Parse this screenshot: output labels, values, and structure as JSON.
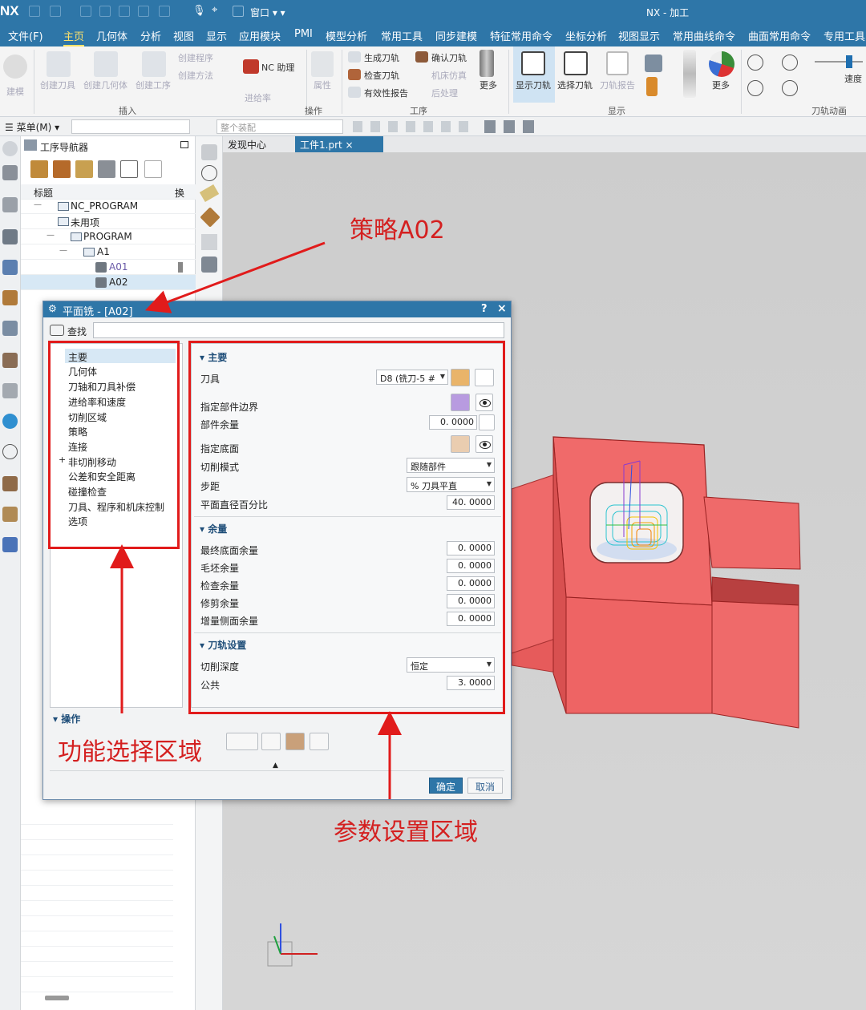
{
  "app": {
    "logo": "NX",
    "window_menu": "窗口",
    "window_title": "NX - 加工"
  },
  "menubar": [
    "文件(F)",
    "主页",
    "几何体",
    "分析",
    "视图",
    "显示",
    "应用模块",
    "PMI",
    "模型分析",
    "常用工具",
    "同步建模",
    "特征常用命令",
    "坐标分析",
    "视图显示",
    "常用曲线命令",
    "曲面常用命令",
    "专用工具"
  ],
  "menubar_active": "主页",
  "ribbon": {
    "b_build": "建模",
    "b_create_tool": "创建刀具",
    "b_create_geom": "创建几何体",
    "b_create_op": "创建工序",
    "b_create_prog": "创建程序",
    "b_create_method": "创建方法",
    "b_nc_assist": "NC 助理",
    "b_props": "属性",
    "b_feed": "进给率",
    "b_gen_path": "生成刀轨",
    "b_confirm_path": "确认刀轨",
    "b_check_path": "检查刀轨",
    "b_machine_sim": "机床仿真",
    "b_validity": "有效性报告",
    "b_postprocess": "后处理",
    "b_more1": "更多",
    "b_show_path": "显示刀轨",
    "b_select_path": "选择刀轨",
    "b_path_report": "刀轨报告",
    "b_more2": "更多",
    "b_speed": "速度",
    "g_insert": "插入",
    "g_operation": "操作",
    "g_workpiece": "工序",
    "g_display": "显示",
    "g_animation": "刀轨动画"
  },
  "toolbar2": {
    "menu_label": "菜单(M)",
    "assembly_combo": "整个装配"
  },
  "navigator": {
    "title": "工序导航器",
    "col_title": "标题",
    "col_change": "换",
    "tree": [
      "NC_PROGRAM",
      "未用项",
      "PROGRAM",
      "A1",
      "A01",
      "A02"
    ]
  },
  "tabs": {
    "discover": "发现中心",
    "part": "工件1.prt"
  },
  "dialog": {
    "title": "平面铣 - [A02]",
    "help": "?",
    "close": "×",
    "search_label": "查找",
    "func_items": [
      "主要",
      "几何体",
      "刀轴和刀具补偿",
      "进给率和速度",
      "切削区域",
      "策略",
      "连接",
      "非切削移动",
      "公差和安全距离",
      "碰撞检查",
      "刀具、程序和机床控制",
      "选项"
    ],
    "expand_item": "+",
    "sec_main": "主要",
    "lbl_tool": "刀具",
    "tool_value": "D8 (铣刀-5 #",
    "lbl_part_boundary": "指定部件边界",
    "lbl_part_stock": "部件余量",
    "part_stock": "0. 0000",
    "lbl_floor": "指定底面",
    "lbl_cut_pattern": "切削模式",
    "cut_pattern": "跟随部件",
    "lbl_stepover": "步距",
    "stepover": "% 刀具平直",
    "lbl_flat_pct": "平面直径百分比",
    "flat_pct": "40. 0000",
    "sec_stock": "余量",
    "lbl_final_floor": "最终底面余量",
    "final_floor": "0. 0000",
    "lbl_blank": "毛坯余量",
    "blank": "0. 0000",
    "lbl_check": "检查余量",
    "check": "0. 0000",
    "lbl_trim": "修剪余量",
    "trim": "0. 0000",
    "lbl_incr_side": "增量侧面余量",
    "incr_side": "0. 0000",
    "sec_path": "刀轨设置",
    "lbl_cut_depth": "切削深度",
    "cut_depth": "恒定",
    "lbl_common": "公共",
    "common": "3. 0000",
    "sec_ops": "操作",
    "ok": "确定",
    "cancel": "取消"
  },
  "annotations": {
    "strategy": "策略A02",
    "func_area": "功能选择区域",
    "param_area": "参数设置区域"
  },
  "colors": {
    "title_blue": "#2e76a8",
    "model_red": "#f06565",
    "annotation_red": "#e11b1b"
  }
}
